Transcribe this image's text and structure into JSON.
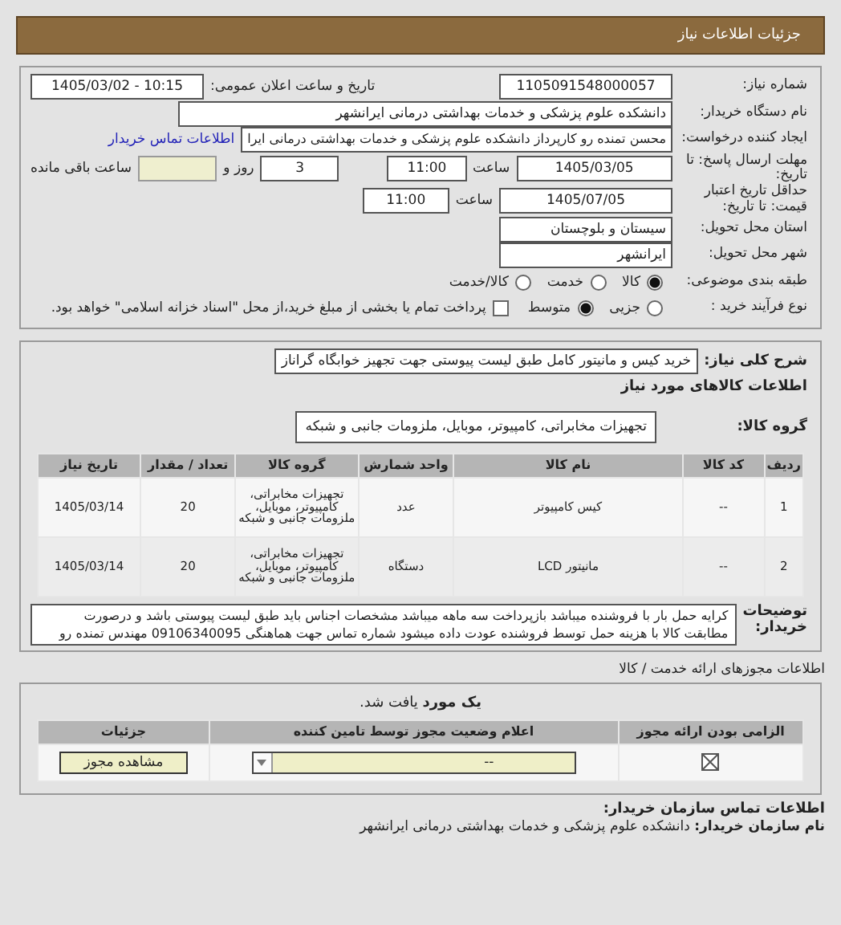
{
  "header": {
    "title": "جزئیات اطلاعات نیاز"
  },
  "need": {
    "number_label": "شماره نیاز:",
    "number": "1105091548000057",
    "announce_label": "تاریخ و ساعت اعلان عمومی:",
    "announce": "1405/03/02 - 10:15",
    "buyer_label": "نام دستگاه خریدار:",
    "buyer": "دانشکده علوم پزشکی و خدمات بهداشتی درمانی ایرانشهر",
    "creator_label": "ایجاد کننده درخواست:",
    "creator": "محسن تمنده رو کارپرداز دانشکده علوم پزشکی و خدمات بهداشتی درمانی ایرا",
    "contact_link": "اطلاعات تماس خریدار",
    "deadline_label": "مهلت ارسال پاسخ: تا تاریخ:",
    "deadline_date": "1405/03/05",
    "time_label": "ساعت",
    "deadline_time": "11:00",
    "days": "3",
    "days_label": "روز و",
    "remaining_label": "ساعت باقی مانده",
    "validity_label": "حداقل تاریخ اعتبار قیمت: تا تاریخ:",
    "validity_date": "1405/07/05",
    "validity_time_label": "ساعت",
    "validity_time": "11:00",
    "province_label": "استان محل تحویل:",
    "province": "سیستان و بلوچستان",
    "city_label": "شهر محل تحویل:",
    "city": "ایرانشهر",
    "classification": {
      "label": "طبقه بندی موضوعی:",
      "options": [
        {
          "label": "کالا",
          "selected": true
        },
        {
          "label": "خدمت",
          "selected": false
        },
        {
          "label": "کالا/خدمت",
          "selected": false
        }
      ]
    },
    "process": {
      "label": "نوع فرآیند خرید :",
      "options": [
        {
          "label": "جزیی",
          "selected": false
        },
        {
          "label": "متوسط",
          "selected": true
        }
      ],
      "treasury": {
        "checked": false,
        "label": "پرداخت تمام یا بخشی از مبلغ خرید،از محل \"اسناد خزانه اسلامی\" خواهد بود."
      }
    }
  },
  "goods": {
    "summary_label": "شرح کلی نیاز:",
    "summary": "خرید کیس و مانیتور کامل طبق لیست پیوستی جهت تجهیز خوابگاه گراناز",
    "section_title": "اطلاعات کالاهای مورد نیاز",
    "group_label": "گروه کالا:",
    "group": "تجهیزات مخابراتی، کامپیوتر، موبایل، ملزومات جانبی و شبکه",
    "table": {
      "columns": [
        "ردیف",
        "کد کالا",
        "نام کالا",
        "واحد شمارش",
        "گروه کالا",
        "تعداد / مقدار",
        "تاریخ نیاز"
      ],
      "rows": [
        [
          "1",
          "--",
          "کیس کامپیوتر",
          "عدد",
          "تجهیزات مخابراتی، کامپیوتر، موبایل، ملزومات جانبی و شبکه",
          "20",
          "1405/03/14"
        ],
        [
          "2",
          "--",
          "مانیتور LCD",
          "دستگاه",
          "تجهیزات مخابراتی، کامپیوتر، موبایل، ملزومات جانبی و شبکه",
          "20",
          "1405/03/14"
        ]
      ]
    },
    "notes_label": "توضیحات خریدار:",
    "notes": "کرایه حمل بار با فروشنده میباشد بازپرداخت سه ماهه میباشد مشخصات اجناس باید طبق لیست پیوستی باشد و درصورت مطابقت کالا با هزینه حمل توسط فروشنده عودت داده میشود شماره تماس جهت هماهنگی 09106340095 مهندس تمنده رو"
  },
  "permits": {
    "section_title": "اطلاعات مجوزهای ارائه خدمت / کالا",
    "found": "**یک مورد** یافت شد.",
    "columns": [
      "الزامی بودن ارائه مجوز",
      "اعلام وضعیت مجوز توسط تامین کننده",
      "جزئیات"
    ],
    "rows": [
      {
        "required": true,
        "status": "--",
        "button": "مشاهده مجوز"
      }
    ]
  },
  "contact": {
    "title": "اطلاعات تماس سازمان خریدار:",
    "org": "**نام سازمان خریدار:** دانشکده علوم پزشکی و خدمات بهداشتی درمانی ایرانشهر"
  }
}
